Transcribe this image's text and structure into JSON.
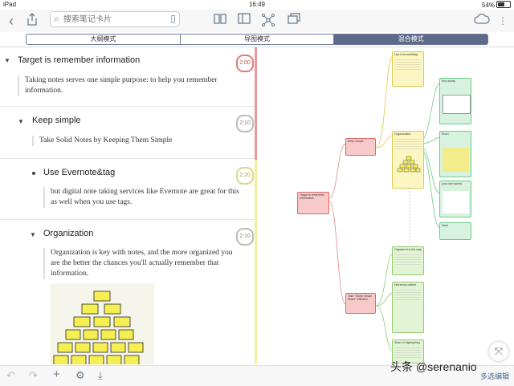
{
  "status": {
    "device": "iPad",
    "time": "16:49",
    "battery": "54%"
  },
  "toolbar": {
    "search_placeholder": "搜索笔记卡片",
    "icons": [
      "back-chevron-icon",
      "share-icon",
      "book-icon",
      "library-icon",
      "sidebar-icon",
      "mindmap-icon",
      "cards-icon",
      "cloud-sync-icon",
      "more-icon"
    ]
  },
  "modes": [
    {
      "label": "大纲模式",
      "active": false
    },
    {
      "label": "导图模式",
      "active": false
    },
    {
      "label": "混合模式",
      "active": true
    }
  ],
  "outline": [
    {
      "title": "Target is remember information",
      "body": "Taking notes serves one simple purpose: to help you remember information.",
      "time": "2:00",
      "color": "#e07a7a"
    },
    {
      "title": "Keep simple",
      "body": "Take Solid Notes by Keeping Them Simple",
      "time": "2:10",
      "color": "#9a9a9a"
    },
    {
      "title": "Use Evernote&tag",
      "body": "but digital note taking services like Evernote are great for this as well when you use tags.",
      "time": "2:20",
      "color": "#c9c96a"
    },
    {
      "title": "Organization",
      "body": "Organization is key with notes, and the more organized you are the better the chances you'll actually remember that information.",
      "time": "2:10",
      "color": "#9a9a9a"
    }
  ],
  "mindmap": {
    "root": "Target is remember information",
    "cards": [
      {
        "name": "keep-simple",
        "text": "Keep simple"
      },
      {
        "name": "take-some-smart",
        "text": "Take \"Some Smart Notes\" effective"
      },
      {
        "name": "use-evernote",
        "text": "Use Evernote&tag"
      },
      {
        "name": "organization",
        "text": "Organization"
      },
      {
        "name": "key-words",
        "text": "Key words"
      },
      {
        "name": "short",
        "text": "Short"
      },
      {
        "name": "your-own-words",
        "text": "your own words"
      },
      {
        "name": "neat",
        "text": "Neat"
      },
      {
        "name": "organized-in-the-way",
        "text": "Organized in the way"
      },
      {
        "name": "hierarchy-outline",
        "text": "Hierarchy outline"
      },
      {
        "name": "short-of-highlighting",
        "text": "Short of highlighting"
      }
    ]
  },
  "bottom": {
    "watermark": "头条 @serenanio",
    "multi_select": "多选编辑"
  }
}
